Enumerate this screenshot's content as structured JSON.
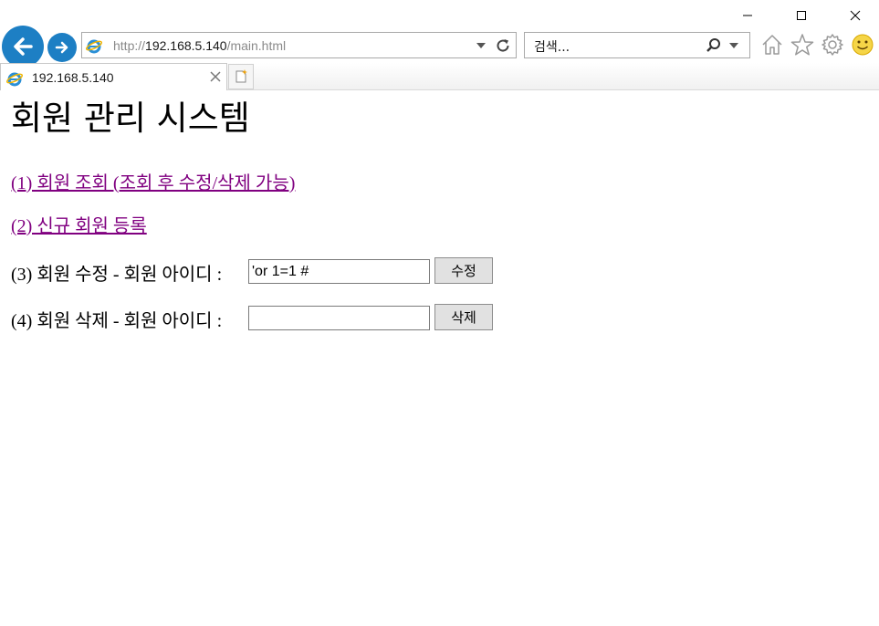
{
  "browser": {
    "address_prefix": "http://",
    "address_host": "192.168.5.140",
    "address_path": "/main.html",
    "search_placeholder": "검색...",
    "tab_title": "192.168.5.140",
    "accent_color": "#1d7fc4"
  },
  "icons": {
    "back": "back-arrow-icon",
    "forward": "forward-arrow-icon",
    "refresh": "refresh-icon",
    "search": "search-icon",
    "home": "home-icon",
    "favorites": "star-icon",
    "tools": "gear-icon",
    "feedback": "smiley-icon"
  },
  "page": {
    "title": "회원 관리 시스템",
    "link_view": "(1) 회원 조회 (조회 후 수정/삭제 가능)",
    "link_register": "(2) 신규 회원 등록",
    "link_color": "#800080",
    "modify": {
      "label": "(3) 회원 수정 - 회원 아이디 :",
      "value": "'or 1=1 #",
      "button": "수정"
    },
    "delete": {
      "label": "(4) 회원 삭제 - 회원 아이디 :",
      "value": "",
      "button": "삭제"
    }
  }
}
